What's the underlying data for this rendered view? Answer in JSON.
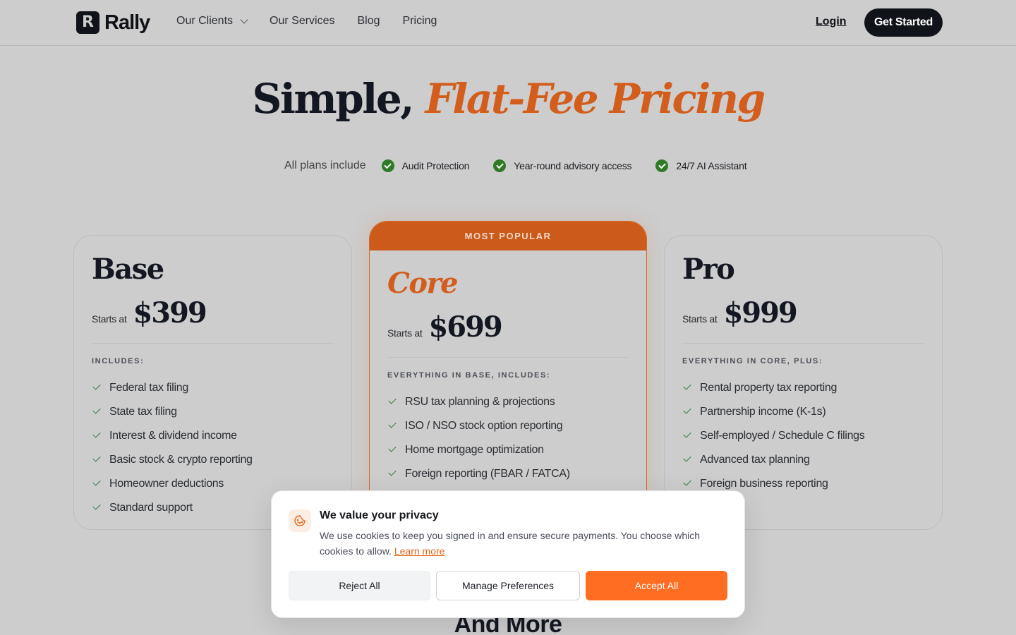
{
  "nav": {
    "brand": "Rally",
    "logo_letter": "R",
    "links": [
      {
        "label": "Our Clients",
        "has_dropdown": true
      },
      {
        "label": "Our Services"
      },
      {
        "label": "Blog"
      },
      {
        "label": "Pricing"
      }
    ],
    "login": "Login",
    "cta": "Get Started"
  },
  "hero": {
    "title_plain": "Simple,",
    "title_accent": "Flat-Fee Pricing",
    "includes_label": "All plans include",
    "includes": [
      "Audit Protection",
      "Year-round advisory access",
      "24/7 AI Assistant"
    ]
  },
  "plans": {
    "base": {
      "name": "Base",
      "starts_label": "Starts at",
      "price": "$399",
      "section_label": "INCLUDES:",
      "features": [
        "Federal tax filing",
        "State tax filing",
        "Interest & dividend income",
        "Basic stock & crypto reporting",
        "Homeowner deductions",
        "Standard support"
      ]
    },
    "core": {
      "badge": "MOST POPULAR",
      "name": "Core",
      "starts_label": "Starts at",
      "price": "$699",
      "section_label": "EVERYTHING IN BASE, INCLUDES:",
      "features": [
        "RSU tax planning & projections",
        "ISO / NSO stock option reporting",
        "Home mortgage optimization",
        "Foreign reporting (FBAR / FATCA)"
      ]
    },
    "pro": {
      "name": "Pro",
      "starts_label": "Starts at",
      "price": "$999",
      "section_label": "EVERYTHING IN CORE, PLUS:",
      "features": [
        "Rental property tax reporting",
        "Partnership income (K-1s)",
        "Self-employed / Schedule C filings",
        "Advanced tax planning",
        "Foreign business reporting"
      ]
    }
  },
  "and_more": "And More",
  "cookie": {
    "title": "We value your privacy",
    "text": "We use cookies to keep you signed in and ensure secure payments. You choose which cookies to allow.",
    "learn_more": "Learn more",
    "reject": "Reject All",
    "manage": "Manage Preferences",
    "accept": "Accept All"
  },
  "colors": {
    "accent": "#d35d1c",
    "accept_button": "#ff6d22",
    "check_green": "#2f7a26",
    "dark": "#11131a"
  }
}
